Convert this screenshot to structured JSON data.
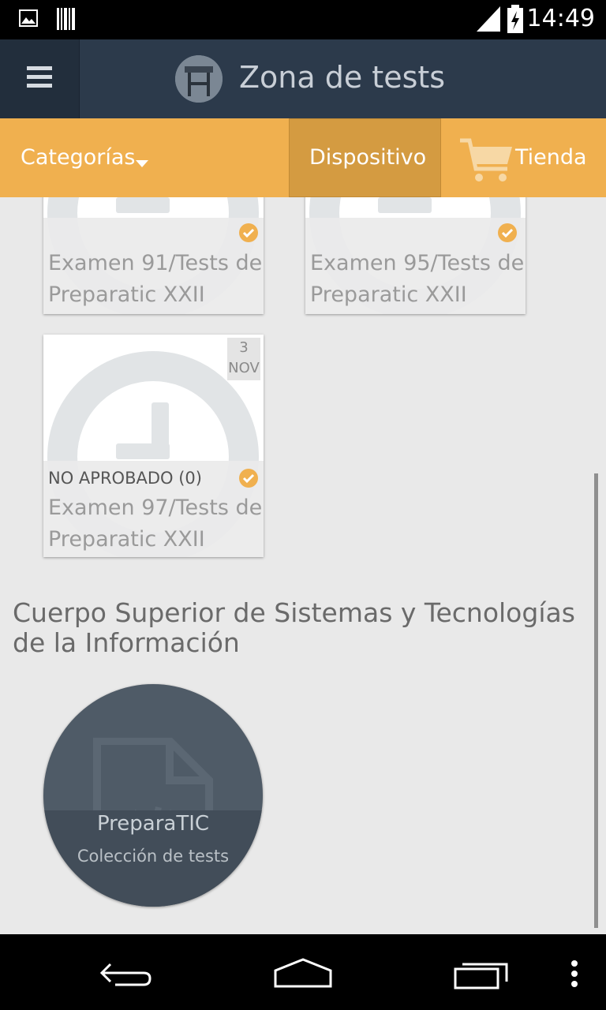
{
  "status_bar": {
    "time": "14:49",
    "icons": [
      "image-notification-icon",
      "barcode-notification-icon",
      "signal-icon",
      "battery-charging-icon"
    ]
  },
  "app_bar": {
    "title": "Zona de tests",
    "menu_icon": "hamburger-menu-icon",
    "logo_icon": "app-logo-icon"
  },
  "tabs": {
    "categorias": "Categorías",
    "dispositivo": "Dispositivo",
    "tienda": "Tienda"
  },
  "exams": [
    {
      "line1": "Examen 91/Tests de",
      "line2": "Preparatic XXII"
    },
    {
      "line1": "Examen 95/Tests de",
      "line2": "Preparatic XXII"
    },
    {
      "line1": "Examen 97/Tests de",
      "line2": "Preparatic XXII",
      "status": "NO APROBADO (0)",
      "date_day": "3",
      "date_month": "NOV"
    }
  ],
  "section": {
    "title": "Cuerpo Superior de Sistemas y Tecnologías de la Información"
  },
  "collection": {
    "name": "PreparaTIC",
    "subtitle": "Colección de tests",
    "icon": "code-file-icon"
  },
  "colors": {
    "appbar": "#2c3a4b",
    "accent": "#f0b04f",
    "active_tab": "#d49b41",
    "background": "#e9e9e9"
  }
}
